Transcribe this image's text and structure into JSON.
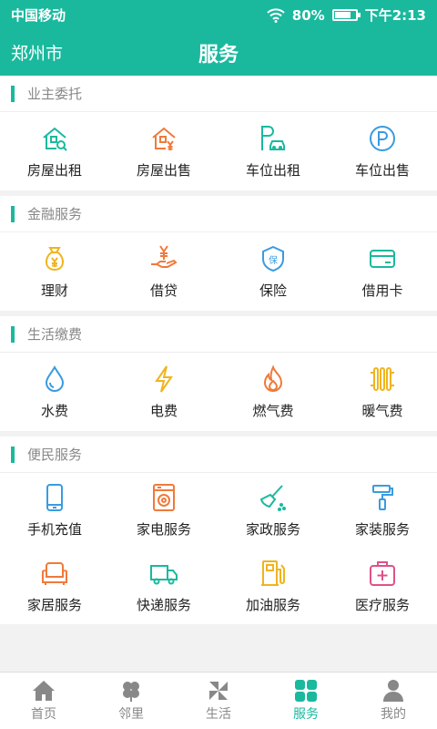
{
  "status": {
    "carrier": "中国移动",
    "battery": "80%",
    "battery_level": 0.8,
    "time": "下午2:13"
  },
  "header": {
    "city": "郑州市",
    "title": "服务"
  },
  "colors": {
    "accent": "#1ab99e",
    "orange": "#f07a3a",
    "yellow": "#f0b41e",
    "blue": "#3a9be0",
    "pink": "#e0508a"
  },
  "sections": [
    {
      "title": "业主委托",
      "items": [
        {
          "label": "房屋出租",
          "icon": "house-search-icon"
        },
        {
          "label": "房屋出售",
          "icon": "house-yen-icon"
        },
        {
          "label": "车位出租",
          "icon": "parking-car-icon"
        },
        {
          "label": "车位出售",
          "icon": "parking-circle-icon"
        }
      ]
    },
    {
      "title": "金融服务",
      "items": [
        {
          "label": "理财",
          "icon": "money-bag-icon"
        },
        {
          "label": "借贷",
          "icon": "loan-hand-icon"
        },
        {
          "label": "保险",
          "icon": "insurance-shield-icon"
        },
        {
          "label": "借用卡",
          "icon": "credit-card-icon"
        }
      ]
    },
    {
      "title": "生活缴费",
      "items": [
        {
          "label": "水费",
          "icon": "water-drop-icon"
        },
        {
          "label": "电费",
          "icon": "lightning-icon"
        },
        {
          "label": "燃气费",
          "icon": "flame-icon"
        },
        {
          "label": "暖气费",
          "icon": "radiator-icon"
        }
      ]
    },
    {
      "title": "便民服务",
      "items": [
        {
          "label": "手机充值",
          "icon": "phone-icon"
        },
        {
          "label": "家电服务",
          "icon": "washing-machine-icon"
        },
        {
          "label": "家政服务",
          "icon": "broom-icon"
        },
        {
          "label": "家装服务",
          "icon": "paint-roller-icon"
        },
        {
          "label": "家居服务",
          "icon": "sofa-icon"
        },
        {
          "label": "快递服务",
          "icon": "truck-icon"
        },
        {
          "label": "加油服务",
          "icon": "fuel-icon"
        },
        {
          "label": "医疗服务",
          "icon": "medical-kit-icon"
        }
      ]
    }
  ],
  "tabs": [
    {
      "label": "首页",
      "icon": "home-icon"
    },
    {
      "label": "邻里",
      "icon": "clover-icon"
    },
    {
      "label": "生活",
      "icon": "pinwheel-icon"
    },
    {
      "label": "服务",
      "icon": "grid-icon",
      "active": true
    },
    {
      "label": "我的",
      "icon": "person-icon"
    }
  ]
}
